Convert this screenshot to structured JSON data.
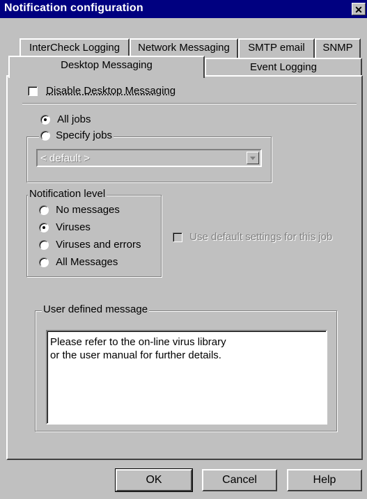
{
  "window": {
    "title": "Notification configuration",
    "close_glyph": "✕"
  },
  "tabs_row1": [
    "InterCheck Logging",
    "Network Messaging",
    "SMTP email",
    "SNMP"
  ],
  "tabs_row2": [
    "Desktop Messaging",
    "Event Logging"
  ],
  "active_tab": "Desktop Messaging",
  "disable_desktop": {
    "label": "Disable Desktop Messaging",
    "checked": false
  },
  "jobs": {
    "all_label": "All jobs",
    "specify_label": "Specify jobs",
    "selected": "All jobs",
    "combo_value": "< default >"
  },
  "notification_level": {
    "legend": "Notification level",
    "options": [
      "No messages",
      "Viruses",
      "Viruses and errors",
      "All Messages"
    ],
    "selected": "Viruses"
  },
  "use_default": {
    "label": "Use default settings for this job",
    "enabled": false
  },
  "user_message": {
    "legend": "User defined message",
    "lines": [
      "Please refer to the on-line virus library",
      "or the user manual for further details."
    ]
  },
  "buttons": {
    "ok": "OK",
    "cancel": "Cancel",
    "help": "Help"
  },
  "colors": {
    "titlebar": "#000080",
    "face": "#c0c0c0"
  }
}
